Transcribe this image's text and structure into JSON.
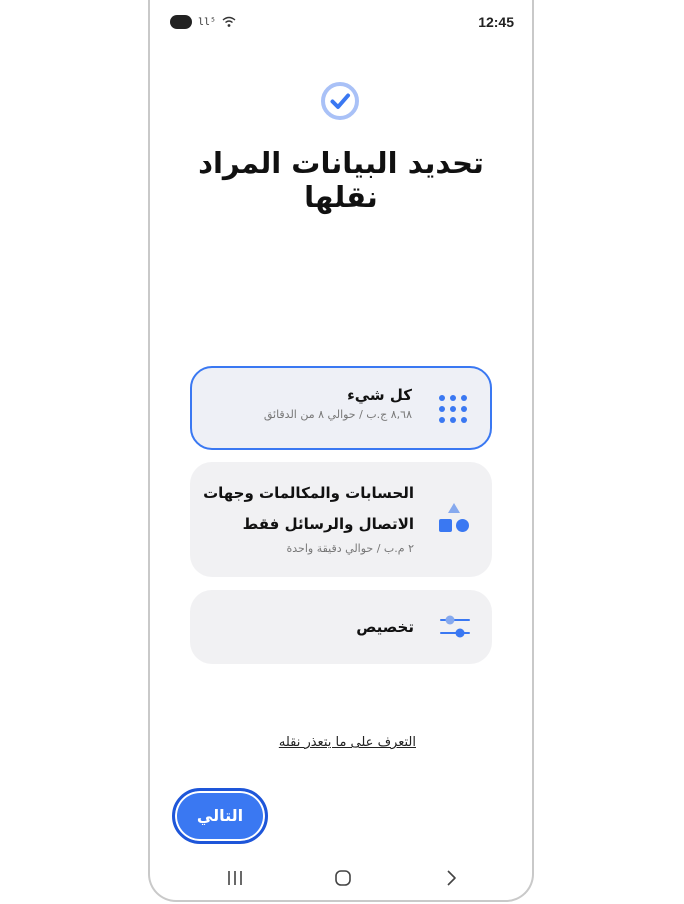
{
  "status_bar": {
    "time": "12:45",
    "signal_text": "ll⁵"
  },
  "page": {
    "title": "تحديد البيانات المراد نقلها"
  },
  "options": [
    {
      "title": "كل شيء",
      "subtitle": "٨,٦٨ ج.ب / حوالي ٨ من الدقائق",
      "icon": "apps-grid-icon",
      "selected": true
    },
    {
      "title_line1": "الحسابات والمكالمات وجهات",
      "title_line2": "الاتصال والرسائل فقط",
      "subtitle": "٢ م.ب / حوالي دقيقة واحدة",
      "icon": "shapes-icon",
      "selected": false
    },
    {
      "title": "تخصيص",
      "icon": "sliders-icon",
      "selected": false
    }
  ],
  "learn_link": "التعرف على ما يتعذر نقله",
  "next_button": "التالي",
  "colors": {
    "accent": "#3a78f2",
    "accent_dark": "#1e56d9",
    "card_bg": "#f1f1f3",
    "check_ring": "#a9c1f7"
  }
}
